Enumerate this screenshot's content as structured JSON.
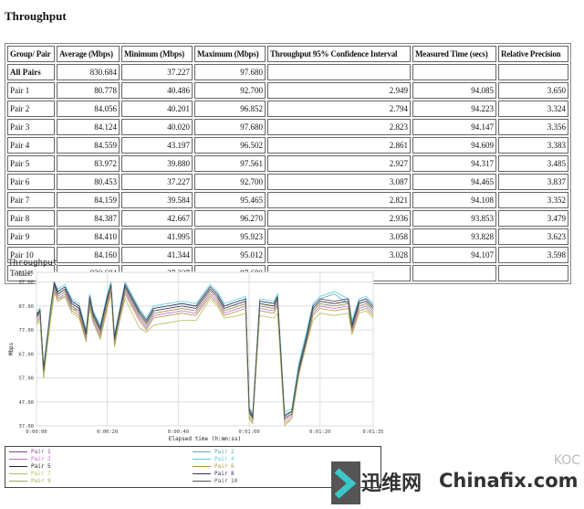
{
  "title": "Throughput",
  "table": {
    "headers": [
      "Group/ Pair",
      "Average (Mbps)",
      "Minimum (Mbps)",
      "Maximum (Mbps)",
      "Throughput 95% Confidence Interval",
      "Measured Time (secs)",
      "Relative Precision"
    ],
    "rows": [
      [
        "All Pairs",
        "830.684",
        "37.227",
        "97.680",
        "",
        "",
        ""
      ],
      [
        "Pair 1",
        "80.778",
        "40.486",
        "92.700",
        "2.949",
        "94.085",
        "3.650"
      ],
      [
        "Pair 2",
        "84.056",
        "40.201",
        "96.852",
        "2.794",
        "94.223",
        "3.324"
      ],
      [
        "Pair 3",
        "84.124",
        "40.020",
        "97.680",
        "2.823",
        "94.147",
        "3.356"
      ],
      [
        "Pair 4",
        "84.559",
        "43.197",
        "96.502",
        "2.861",
        "94.609",
        "3.383"
      ],
      [
        "Pair 5",
        "83.972",
        "39.880",
        "97.561",
        "2.927",
        "94.317",
        "3.485"
      ],
      [
        "Pair 6",
        "80.453",
        "37.227",
        "92.700",
        "3.087",
        "94.465",
        "3.837"
      ],
      [
        "Pair 7",
        "84.159",
        "39.584",
        "95.465",
        "2.821",
        "94.108",
        "3.352"
      ],
      [
        "Pair 8",
        "84.387",
        "42.667",
        "96.270",
        "2.936",
        "93.853",
        "3.479"
      ],
      [
        "Pair 9",
        "84.410",
        "41.995",
        "95.923",
        "3.058",
        "93.828",
        "3.623"
      ],
      [
        "Pair 10",
        "84.160",
        "41.344",
        "95.012",
        "3.028",
        "94.107",
        "3.598"
      ],
      [
        "Totals:",
        "830.684",
        "37.227",
        "97.680",
        "",
        "",
        ""
      ]
    ]
  },
  "chart_data": {
    "type": "line",
    "title": "Throughput",
    "xlabel": "Elapsed time (h:mm:ss)",
    "ylabel": "Mbps",
    "ylim": [
      37,
      101.05
    ],
    "yticks": [
      "37.00",
      "47.00",
      "57.00",
      "67.00",
      "77.00",
      "87.00",
      "97.00",
      "101.05"
    ],
    "xticks": [
      "0:00:00",
      "0:00:20",
      "0:00:40",
      "0:01:00",
      "0:01:20",
      "0:01:35"
    ],
    "grid": true,
    "legend_position": "bottom",
    "x": [
      "0:00:00",
      "0:00:01",
      "0:00:02",
      "0:00:04",
      "0:00:05",
      "0:00:06",
      "0:00:08",
      "0:00:10",
      "0:00:12",
      "0:00:14",
      "0:00:15",
      "0:00:16",
      "0:00:18",
      "0:00:20",
      "0:00:21",
      "0:00:22",
      "0:00:25",
      "0:00:29",
      "0:00:31",
      "0:00:33",
      "0:00:37",
      "0:00:41",
      "0:00:45",
      "0:00:49",
      "0:00:51",
      "0:00:53",
      "0:00:57",
      "0:00:59",
      "0:01:00",
      "0:01:01",
      "0:01:03",
      "0:01:07",
      "0:01:08",
      "0:01:10",
      "0:01:12",
      "0:01:14",
      "0:01:16",
      "0:01:18",
      "0:01:20",
      "0:01:24",
      "0:01:28",
      "0:01:29",
      "0:01:31",
      "0:01:33",
      "0:01:35"
    ],
    "series": [
      {
        "name": "Pair 1",
        "color": "#7b4a8c",
        "values": [
          82,
          86,
          58,
          84,
          95,
          91,
          93,
          87,
          85,
          74,
          89,
          82,
          76,
          89,
          95,
          72,
          94,
          83,
          79,
          84,
          85,
          86,
          85,
          93,
          90,
          85,
          87,
          88,
          42,
          41,
          87,
          86,
          89,
          41,
          43,
          61,
          73,
          85,
          88,
          87,
          88,
          79,
          87,
          88,
          85
        ]
      },
      {
        "name": "Pair 2",
        "color": "#66aaaa",
        "values": [
          84,
          84,
          61,
          86,
          96,
          93,
          95,
          89,
          87,
          76,
          91,
          84,
          78,
          91,
          97,
          74,
          96,
          85,
          81,
          86,
          87,
          88,
          87,
          95,
          92,
          87,
          89,
          90,
          44,
          41,
          89,
          88,
          91,
          42,
          43,
          62,
          74,
          87,
          90,
          92,
          88,
          80,
          89,
          90,
          87
        ]
      },
      {
        "name": "Pair 3",
        "color": "#cc66cc",
        "values": [
          81,
          83,
          59,
          83,
          94,
          90,
          92,
          86,
          84,
          73,
          88,
          81,
          75,
          88,
          94,
          71,
          93,
          82,
          78,
          83,
          84,
          85,
          84,
          92,
          89,
          84,
          86,
          87,
          41,
          39,
          86,
          85,
          88,
          39,
          41,
          59,
          71,
          84,
          87,
          86,
          87,
          77,
          86,
          87,
          84
        ]
      },
      {
        "name": "Pair 4",
        "color": "#55ccdd",
        "values": [
          85,
          86,
          62,
          87,
          97,
          94,
          96,
          90,
          88,
          77,
          92,
          85,
          79,
          92,
          97,
          75,
          97,
          86,
          82,
          87,
          88,
          89,
          88,
          96,
          93,
          88,
          90,
          91,
          45,
          42,
          90,
          89,
          92,
          43,
          44,
          63,
          75,
          88,
          91,
          93,
          90,
          81,
          90,
          91,
          88
        ]
      },
      {
        "name": "Pair 5",
        "color": "#222222",
        "values": [
          83,
          84,
          60,
          85,
          96,
          92,
          94,
          88,
          86,
          74,
          90,
          83,
          77,
          90,
          95,
          73,
          95,
          84,
          80,
          85,
          86,
          87,
          86,
          94,
          91,
          86,
          88,
          89,
          43,
          40,
          88,
          87,
          90,
          40,
          42,
          60,
          72,
          86,
          89,
          88,
          89,
          78,
          88,
          89,
          86
        ]
      },
      {
        "name": "Pair 6",
        "color": "#aa9944",
        "values": [
          80,
          82,
          57,
          82,
          93,
          89,
          91,
          85,
          83,
          72,
          87,
          80,
          74,
          87,
          93,
          70,
          92,
          81,
          77,
          82,
          83,
          84,
          83,
          91,
          88,
          83,
          85,
          86,
          40,
          38,
          85,
          84,
          87,
          38,
          40,
          58,
          70,
          83,
          86,
          85,
          86,
          76,
          85,
          86,
          83
        ]
      },
      {
        "name": "Pair 7",
        "color": "#bbbb66",
        "values": [
          79,
          81,
          58,
          81,
          92,
          90,
          91,
          84,
          82,
          72,
          86,
          80,
          73,
          86,
          92,
          72,
          90,
          78,
          76,
          79,
          80,
          81,
          81,
          90,
          87,
          82,
          83,
          84,
          41,
          39,
          83,
          82,
          84,
          37,
          40,
          58,
          70,
          81,
          84,
          83,
          84,
          75,
          84,
          85,
          82
        ]
      },
      {
        "name": "Pair 8",
        "color": "#333366",
        "values": [
          84,
          85,
          61,
          85,
          97,
          93,
          95,
          89,
          87,
          76,
          91,
          84,
          78,
          91,
          96,
          74,
          96,
          85,
          81,
          86,
          87,
          88,
          87,
          95,
          92,
          87,
          89,
          90,
          44,
          41,
          89,
          88,
          91,
          41,
          43,
          61,
          73,
          87,
          90,
          89,
          90,
          79,
          89,
          90,
          87
        ]
      },
      {
        "name": "Pair 9",
        "color": "#99aa66",
        "values": [
          82,
          84,
          59,
          84,
          95,
          91,
          93,
          86,
          85,
          74,
          89,
          82,
          76,
          89,
          95,
          72,
          94,
          83,
          79,
          84,
          85,
          86,
          85,
          93,
          90,
          85,
          87,
          88,
          42,
          40,
          87,
          86,
          89,
          40,
          42,
          60,
          72,
          85,
          88,
          87,
          88,
          78,
          87,
          88,
          85
        ]
      },
      {
        "name": "Pair 10",
        "color": "#555555",
        "values": [
          83,
          85,
          60,
          86,
          96,
          92,
          94,
          88,
          86,
          75,
          90,
          83,
          77,
          90,
          96,
          73,
          95,
          84,
          80,
          85,
          86,
          87,
          86,
          94,
          91,
          86,
          88,
          89,
          43,
          40,
          88,
          87,
          90,
          40,
          42,
          60,
          72,
          86,
          89,
          88,
          89,
          78,
          88,
          89,
          86
        ]
      }
    ]
  },
  "watermark": {
    "cn": "迅维网",
    "en": "Chinafix.com",
    "corner": "KOC",
    "accent": "#3cc8c8"
  }
}
